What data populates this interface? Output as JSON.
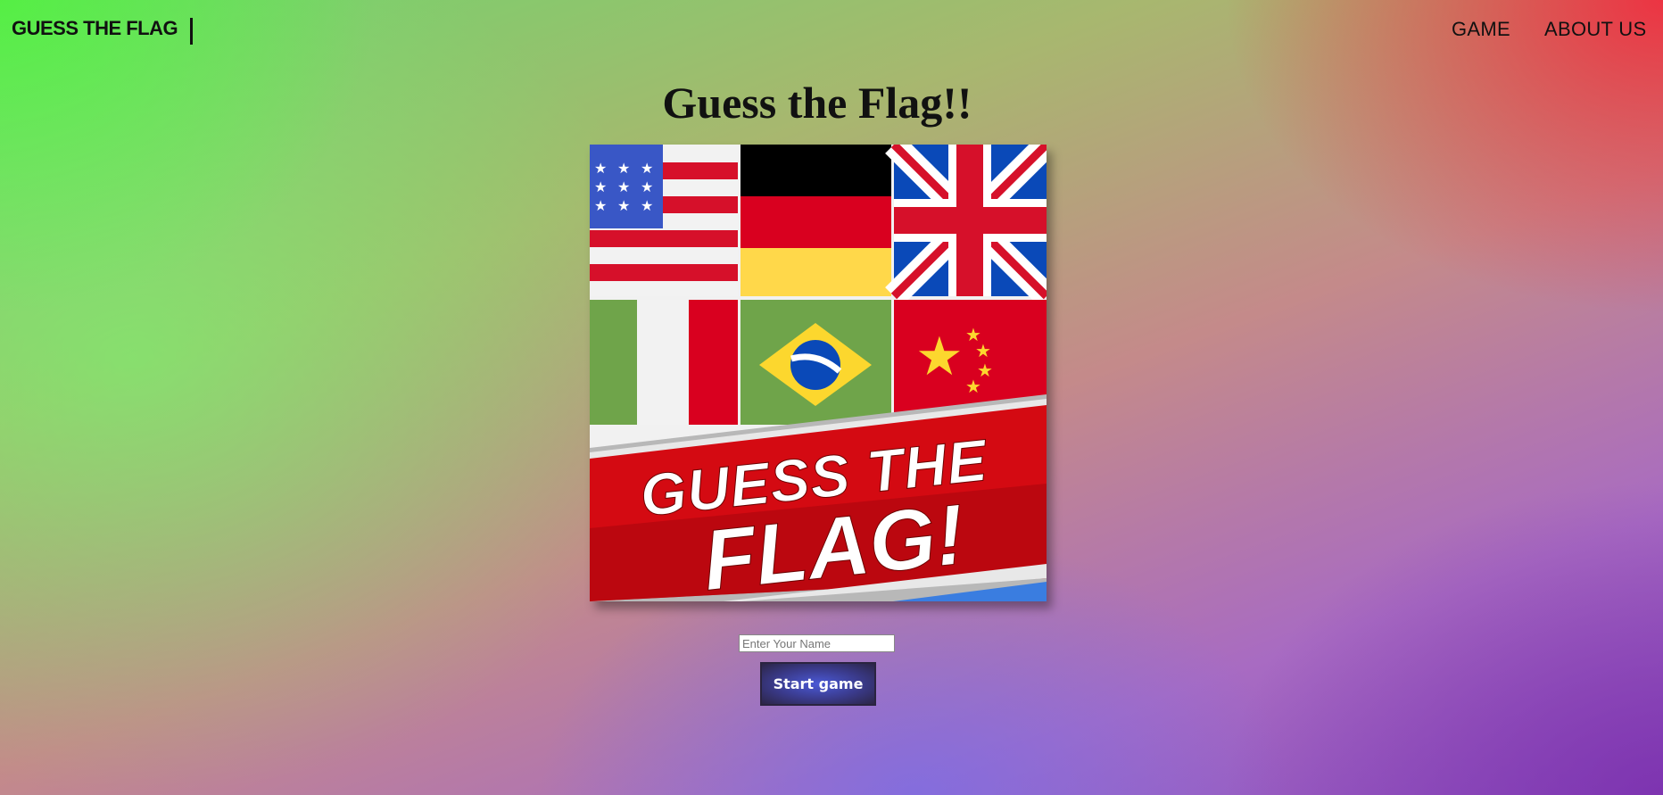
{
  "navbar": {
    "brand": "GUESS THE FLAG",
    "links": [
      {
        "label": "GAME"
      },
      {
        "label": "ABOUT US"
      }
    ]
  },
  "main": {
    "title": "Guess the Flag!!",
    "hero_banner": {
      "line1": "GUESS THE",
      "line2": "FLAG!",
      "flags": [
        "usa-flag",
        "germany-flag",
        "uk-flag",
        "italy-flag",
        "brazil-flag",
        "china-flag"
      ]
    },
    "name_input": {
      "value": "",
      "placeholder": "Enter Your Name"
    },
    "start_button": {
      "label": "Start game"
    }
  },
  "colors": {
    "text": "#111111",
    "button_bg": "#3a3a8a",
    "banner_red": "#d40a12"
  }
}
